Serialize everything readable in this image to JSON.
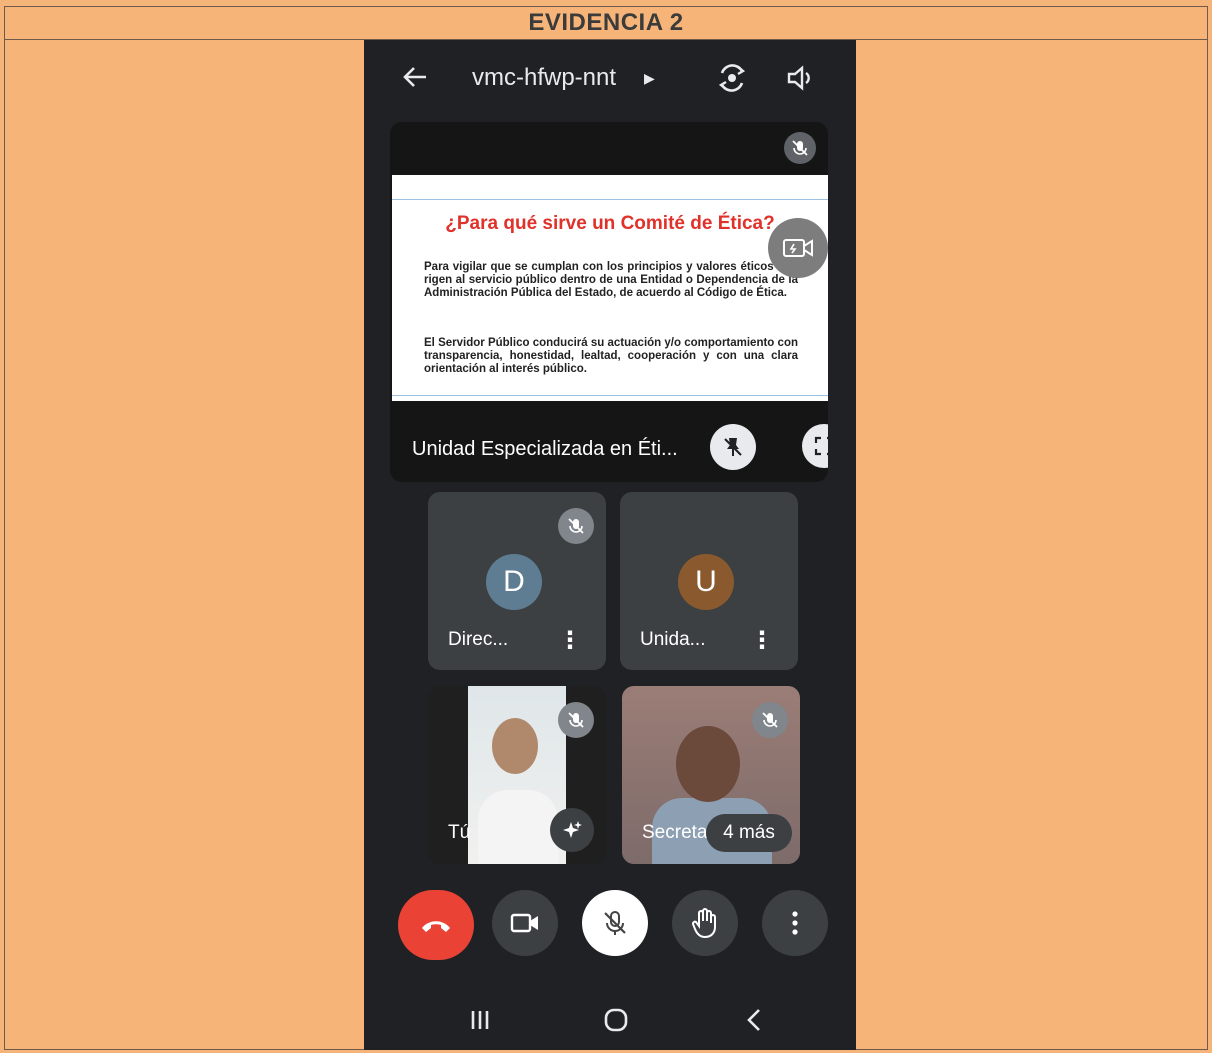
{
  "document": {
    "title": "EVIDENCIA 2"
  },
  "meet": {
    "meeting_code": "vmc-hfwp-nnt",
    "icons": {
      "back": "back-arrow-icon",
      "code_expand": "triangle-right-icon",
      "switch_camera": "switch-camera-icon",
      "speaker": "speaker-icon"
    }
  },
  "presentation": {
    "presenter_name": "Unidad Especializada en Éti...",
    "slide": {
      "title": "¿Para qué sirve un Comité de Ética?",
      "paragraph_1": "Para vigilar que se cumplan con los principios y valores éticos que rigen al servicio público dentro de una Entidad o Dependencia de la Administración Pública del Estado, de acuerdo al Código de Ética.",
      "paragraph_2": "El Servidor Público conducirá su actuación y/o comportamiento con transparencia, honestidad, lealtad, cooperación y con una clara orientación al interés público."
    }
  },
  "participants": [
    {
      "initial": "D",
      "name": "Direc...",
      "avatar_color": "#5f7d92"
    },
    {
      "initial": "U",
      "name": "Unida...",
      "avatar_color": "#8a5a2e"
    },
    {
      "name": "Tú"
    },
    {
      "name": "Secreta",
      "more_count": "4 más"
    }
  ],
  "controls": {
    "end_call_color": "#ea4335",
    "icons": [
      "end-call-icon",
      "camera-icon",
      "mic-off-icon",
      "raise-hand-icon",
      "more-options-icon"
    ]
  }
}
